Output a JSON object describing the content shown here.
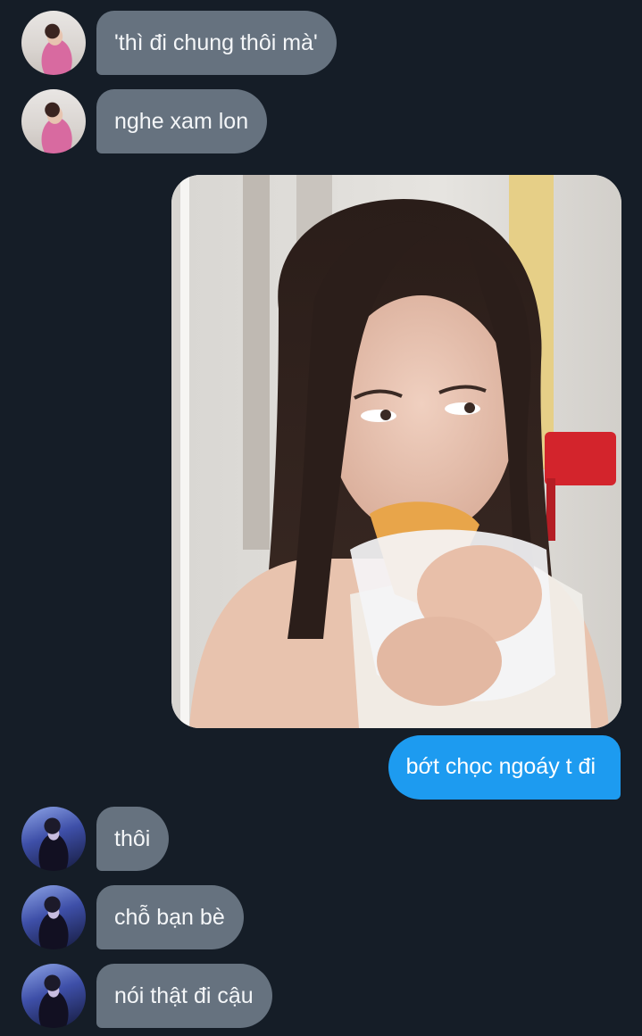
{
  "conversation": {
    "messages": [
      {
        "from": "other",
        "avatar": "avatar-pink-outfit",
        "text": "'thì đi chung thôi mà'"
      },
      {
        "from": "other",
        "avatar": "avatar-pink-outfit",
        "text": "nghe xam lon"
      },
      {
        "from": "me",
        "type": "photo",
        "image": "photo-girl-eating-ice-cream-cone"
      },
      {
        "from": "me",
        "text": "bớt chọc ngoáy t đi"
      },
      {
        "from": "other",
        "avatar": "avatar-blue-tint",
        "text": "thôi"
      },
      {
        "from": "other",
        "avatar": "avatar-blue-tint",
        "text": "chỗ bạn bè"
      },
      {
        "from": "other",
        "avatar": "avatar-blue-tint",
        "text": "nói thật đi cậu"
      }
    ]
  },
  "colors": {
    "background": "#151d27",
    "incoming_bubble": "#66727f",
    "outgoing_bubble": "#1d9bf0"
  }
}
